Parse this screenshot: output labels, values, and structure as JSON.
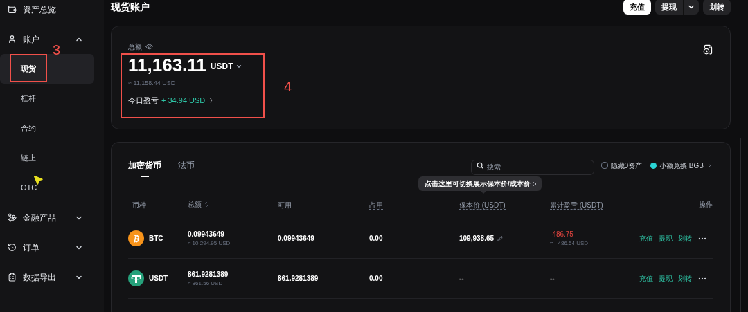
{
  "sidebar": {
    "items": [
      {
        "label": "资产总览"
      },
      {
        "label": "账户",
        "expanded": true,
        "children": [
          {
            "label": "现货",
            "selected": true
          },
          {
            "label": "杠杆",
            "selected": false
          },
          {
            "label": "合约",
            "selected": false
          },
          {
            "label": "链上",
            "selected": false
          },
          {
            "label": "OTC",
            "selected": false
          }
        ]
      },
      {
        "label": "金融产品",
        "expanded": false
      },
      {
        "label": "订单",
        "expanded": false
      },
      {
        "label": "数据导出",
        "expanded": false
      }
    ]
  },
  "header": {
    "title": "现货账户",
    "buttons": [
      {
        "label": "充值",
        "kind": "primary"
      },
      {
        "label": "提现",
        "kind": "split"
      },
      {
        "label": "划转",
        "kind": "plain"
      }
    ]
  },
  "summary": {
    "label": "总额",
    "amount": "11,163.11",
    "currency": "USDT",
    "approx": "≈ 11,158.44 USD",
    "pnl_label": "今日盈亏",
    "pnl_value": "+ 34.94 USD"
  },
  "annotations": [
    {
      "label": "3"
    },
    {
      "label": "4"
    }
  ],
  "assets": {
    "tabs": [
      {
        "label": "加密货币",
        "selected": true
      },
      {
        "label": "法币",
        "selected": false
      }
    ],
    "search": {
      "placeholder": "搜索"
    },
    "hide_zero": {
      "label": "隐藏0资产",
      "checked": false
    },
    "convert": "小额兑换 BGB",
    "tooltip": "点击这里可切换展示保本价/成本价",
    "columns": [
      {
        "label": "币种",
        "kind": "plain"
      },
      {
        "label": "总额",
        "kind": "sort"
      },
      {
        "label": "可用",
        "kind": "plain"
      },
      {
        "label": "占用",
        "kind": "dotted"
      },
      {
        "label": "保本价 (USDT)",
        "kind": "dotted"
      },
      {
        "label": "累计盈亏 (USDT)",
        "kind": "dotted"
      },
      {
        "label": "操作",
        "kind": "right"
      }
    ],
    "rows": [
      {
        "coin": "BTC",
        "kind": "btc",
        "total": "0.09943649",
        "total_usd": "≈ 10,294.95 USD",
        "available": "0.09943649",
        "occupied": "0.00",
        "cost": "109,938.65",
        "editable": true,
        "pnl": "-486.75",
        "pnl_usd": "≈ - 486.54 USD",
        "negative": true,
        "actions": [
          "充值",
          "提现",
          "划转"
        ]
      },
      {
        "coin": "USDT",
        "kind": "usdt",
        "total": "861.9281389",
        "total_usd": "≈ 861.56 USD",
        "available": "861.9281389",
        "occupied": "0.00",
        "cost": "--",
        "editable": false,
        "pnl": "--",
        "negative": false,
        "actions": [
          "充值",
          "提现",
          "划转"
        ]
      }
    ]
  }
}
